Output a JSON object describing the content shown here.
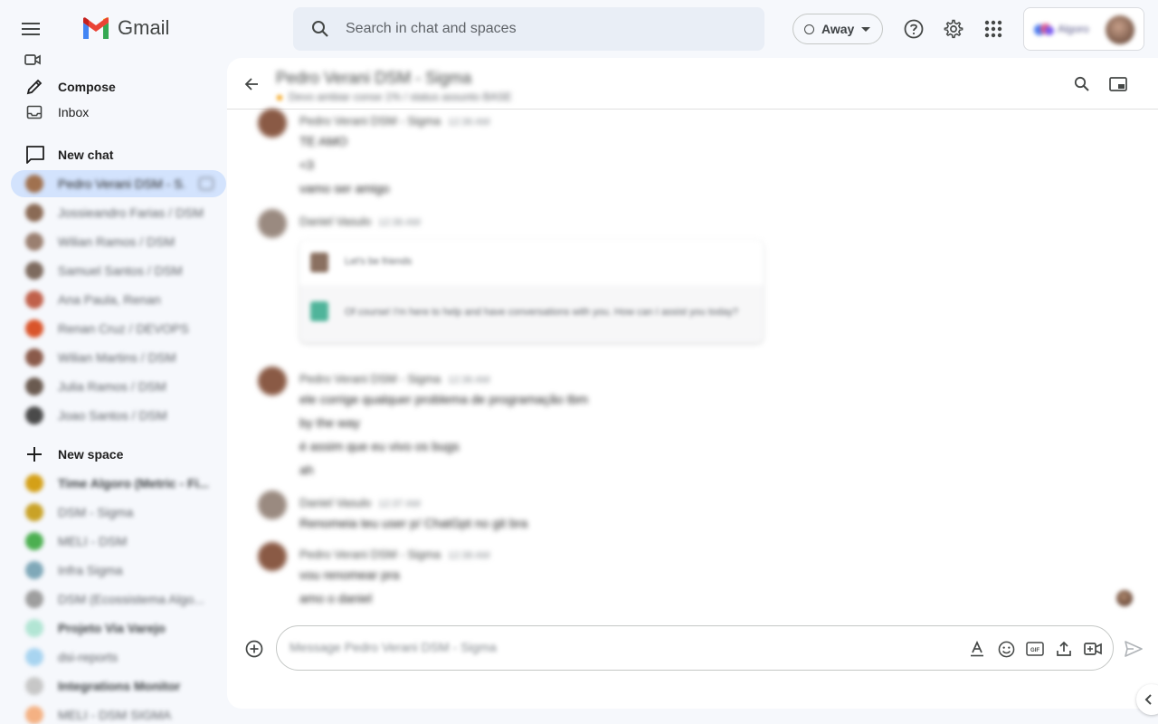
{
  "app": {
    "name": "Gmail"
  },
  "search": {
    "placeholder": "Search in chat and spaces"
  },
  "status": {
    "label": "Away"
  },
  "account": {
    "org_label": "Algoro"
  },
  "sidebar": {
    "compose_label": "Compose",
    "inbox_label": "Inbox",
    "new_chat_label": "New chat",
    "new_space_label": "New space",
    "chats": [
      {
        "name": "Pedro Verani DSM - S...",
        "color": "#a0714f",
        "active": true
      },
      {
        "name": "Jossieandro Farias / DSM",
        "color": "#8a6a55",
        "active": false
      },
      {
        "name": "Wilian Ramos / DSM",
        "color": "#9a7f70",
        "active": false
      },
      {
        "name": "Samuel Santos / DSM",
        "color": "#7d6a5e",
        "active": false
      },
      {
        "name": "Ana Paula, Renan",
        "color": "#c0604a",
        "active": false
      },
      {
        "name": "Renan Cruz / DEVOPS",
        "color": "#d9542a",
        "active": false
      },
      {
        "name": "Wilian Martins / DSM",
        "color": "#8a5a4a",
        "active": false
      },
      {
        "name": "Julia Ramos / DSM",
        "color": "#6a5a50",
        "active": false
      },
      {
        "name": "Joao Santos / DSM",
        "color": "#4a4a4a",
        "active": false
      }
    ],
    "spaces": [
      {
        "name": "Time Algoro (Metric - Fi...",
        "color": "#d4a017",
        "bold": true
      },
      {
        "name": "DSM - Sigma",
        "color": "#c9a227",
        "bold": false
      },
      {
        "name": "MELI - DSM",
        "color": "#4caf50",
        "bold": false
      },
      {
        "name": "Infra Sigma",
        "color": "#7fa8b8",
        "bold": false
      },
      {
        "name": "DSM (Ecossistema Algo...",
        "color": "#9e9e9e",
        "bold": false
      },
      {
        "name": "Projeto Via Varejo",
        "color": "#b2e5d4",
        "bold": true
      },
      {
        "name": "dsi-reports",
        "color": "#a8d4f0",
        "bold": false
      },
      {
        "name": "Integrations Monitor",
        "color": "#c7c7c7",
        "bold": true
      },
      {
        "name": "MELI - DSM SIGMA",
        "color": "#f4b183",
        "bold": false
      }
    ]
  },
  "conversation": {
    "title": "Pedro Verani DSM - Sigma",
    "subtitle": "Devo ambiar conse 1% / status assunto BASE",
    "messages": [
      {
        "sender": "Pedro Verani DSM - Sigma",
        "time": "12:36 AM",
        "lines": [
          "TE AMO",
          "<3",
          "vamo ser amigo"
        ]
      },
      {
        "sender": "Daniel Vasulo",
        "time": "12:36 AM",
        "card": {
          "prompt": "Let's be friends",
          "reply": "Of course! I'm here to help and have conversations with you. How can I assist you today?"
        }
      },
      {
        "sender": "Pedro Verani DSM - Sigma",
        "time": "12:36 AM",
        "lines": [
          "ele corrige qualquer problema de programação tbm",
          "by the way",
          "é assim que eu vivo os bugs",
          "ah"
        ]
      },
      {
        "sender": "Daniel Vasulo",
        "time": "12:37 AM",
        "lines": [
          "Renomeia teu user p/ ChatGpt no git bra"
        ]
      },
      {
        "sender": "Pedro Verani DSM - Sigma",
        "time": "12:38 AM",
        "lines": [
          "vou renomear pra",
          "amo o daniel"
        ]
      }
    ]
  },
  "composer": {
    "placeholder": "Message Pedro Verani DSM - Sigma"
  },
  "colors": {
    "accent": "#0b57d0",
    "active_bg": "#d3e3fd",
    "page_bg": "#f6f8fc"
  }
}
